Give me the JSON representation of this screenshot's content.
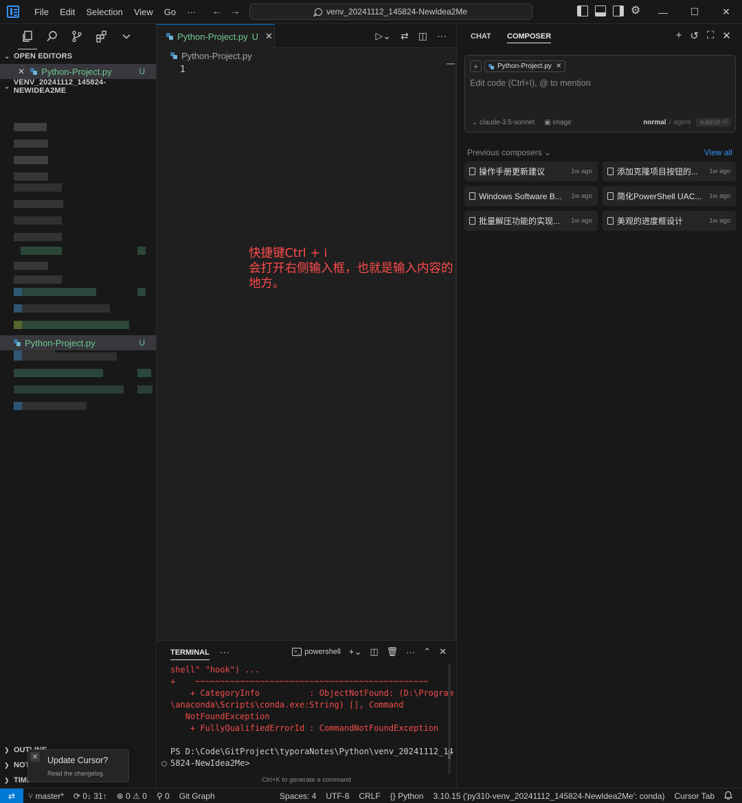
{
  "titlebar": {
    "menu": [
      "File",
      "Edit",
      "Selection",
      "View",
      "Go"
    ],
    "more": "···",
    "search_text": "venv_20241112_145824-NewIdea2Me",
    "controls": {
      "minimize": "—",
      "maximize": "☐",
      "close": "✕"
    },
    "gear": "⚙"
  },
  "sidebar": {
    "open_editors_title": "OPEN EDITORS",
    "open_editor_file": "Python-Project.py",
    "open_editor_status": "U",
    "open_editor_close": "✕",
    "workspace_title": "VENV_20241112_145824-NEWIDEA2ME",
    "tree_file": "Python-Project.py",
    "tree_file_status": "U",
    "outline_title": "OUTLINE",
    "notes_title": "NOTES",
    "timeline_title": "TIMELINE",
    "chevron": "❯",
    "chevron_open": "⌄"
  },
  "toast": {
    "title": "Update Cursor?",
    "subtitle": "Read the changelog.",
    "close": "✕"
  },
  "editor": {
    "tab_name": "Python-Project.py",
    "tab_status": "U",
    "tab_close": "✕",
    "breadcrumb_file": "Python-Project.py",
    "line_number": "1",
    "more_actions": "···",
    "annotation_line1": "快捷键Ctrl + i",
    "annotation_line2": "会打开右侧输入框，也就是输入内容的地方。"
  },
  "terminal": {
    "tab": "TERMINAL",
    "more": "···",
    "shell": "powershell",
    "shell_glyph": ">_",
    "lines": [
      {
        "text": "shell\" \"hook\") ...",
        "kind": "err"
      },
      {
        "text": "+    ~~~~~~~~~~~~~~~~~~~~~~~~~~~~~~~~~~~~~~~~~~~~~~~",
        "kind": "err"
      },
      {
        "text": "    + CategoryInfo          : ObjectNotFound: (D:\\Program",
        "kind": "err"
      },
      {
        "text": "\\anaconda\\Scripts\\conda.exe:String) [], Command",
        "kind": "err"
      },
      {
        "text": "   NotFoundException",
        "kind": "err"
      },
      {
        "text": "    + FullyQualifiedErrorId : CommandNotFoundException",
        "kind": "err"
      },
      {
        "text": " ",
        "kind": "norm"
      },
      {
        "text": "PS D:\\Code\\GitProject\\typoraNotes\\Python\\venv_20241112_14",
        "kind": "norm"
      },
      {
        "text": "5824-NewIdea2Me>",
        "kind": "norm"
      }
    ],
    "hint": "Ctrl+K to generate a command"
  },
  "composer": {
    "tabs": [
      "CHAT",
      "COMPOSER"
    ],
    "active_tab": "COMPOSER",
    "actions": {
      "new": "+",
      "history": "↺",
      "expand": "⛶",
      "close": "✕"
    },
    "add_context": "+",
    "context_file": "Python-Project.py",
    "context_close": "✕",
    "placeholder": "Edit code (Ctrl+I), @ to mention",
    "model": "claude-3.5-sonnet",
    "image_label": "image",
    "mode_normal": "normal",
    "mode_sep": "/",
    "mode_agent": "agent",
    "submit": "submit ⏎",
    "previous_header": "Previous composers ⌄",
    "view_all": "View all",
    "items": [
      {
        "title": "操作手册更新建议",
        "time": "1w ago"
      },
      {
        "title": "添加克隆项目按钮的...",
        "time": "1w ago"
      },
      {
        "title": "Windows Software B...",
        "time": "1w ago"
      },
      {
        "title": "简化PowerShell UAC...",
        "time": "1w ago"
      },
      {
        "title": "批量解压功能的实现...",
        "time": "1w ago"
      },
      {
        "title": "美观的进度框设计",
        "time": "1w ago"
      }
    ]
  },
  "statusbar": {
    "remote": "⇄",
    "branch": "master*",
    "sync": "0↓ 31↑",
    "errors": "⊗ 0",
    "warnings": "⚠ 0",
    "ports": "0",
    "git_graph": "Git Graph",
    "spaces": "Spaces: 4",
    "encoding": "UTF-8",
    "eol": "CRLF",
    "language": "Python",
    "interpreter": "3.10.15 ('py310-venv_20241112_145824-NewIdea2Me': conda)",
    "cursor_tab": "Cursor Tab",
    "bell": "🔔"
  }
}
